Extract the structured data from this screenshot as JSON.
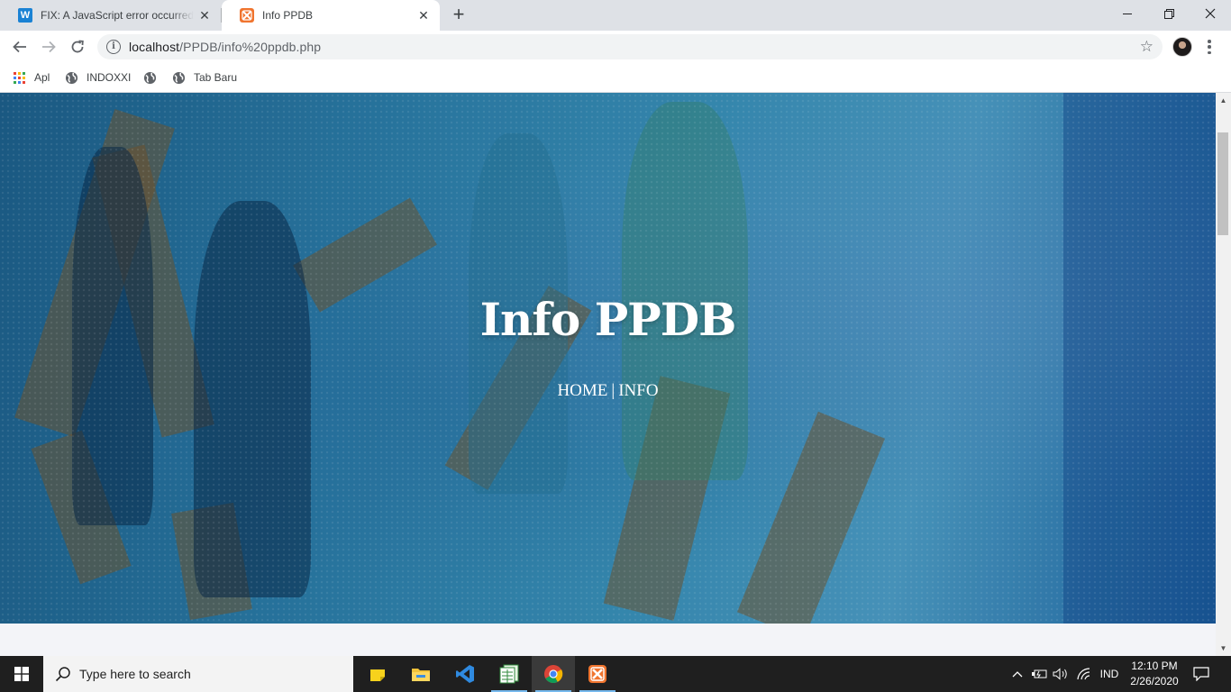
{
  "browser": {
    "tabs": [
      {
        "title": "FIX: A JavaScript error occurred in",
        "favicon": "W",
        "active": false
      },
      {
        "title": "Info PPDB",
        "favicon": "xampp",
        "active": true
      }
    ],
    "new_tab_symbol": "+",
    "url_host": "localhost",
    "url_path": "/PPDB/info%20ppdb.php",
    "bookmarks": [
      {
        "label": "Apl",
        "icon": "apps-grid-icon"
      },
      {
        "label": "INDOXXI",
        "icon": "globe-icon"
      },
      {
        "label": "",
        "icon": "globe-icon"
      },
      {
        "label": "Tab Baru",
        "icon": "globe-icon"
      }
    ]
  },
  "page": {
    "hero_title": "Info PPDB",
    "breadcrumb_home": "HOME",
    "breadcrumb_separator": "|",
    "breadcrumb_current": "INFO",
    "hero_color": "#2c7ea7"
  },
  "taskbar": {
    "search_placeholder": "Type here to search",
    "apps": [
      "sticky-notes-icon",
      "file-explorer-icon",
      "vscode-icon",
      "sheets-icon",
      "chrome-icon",
      "xampp-icon"
    ],
    "language": "IND",
    "time": "12:10 PM",
    "date": "2/26/2020"
  }
}
